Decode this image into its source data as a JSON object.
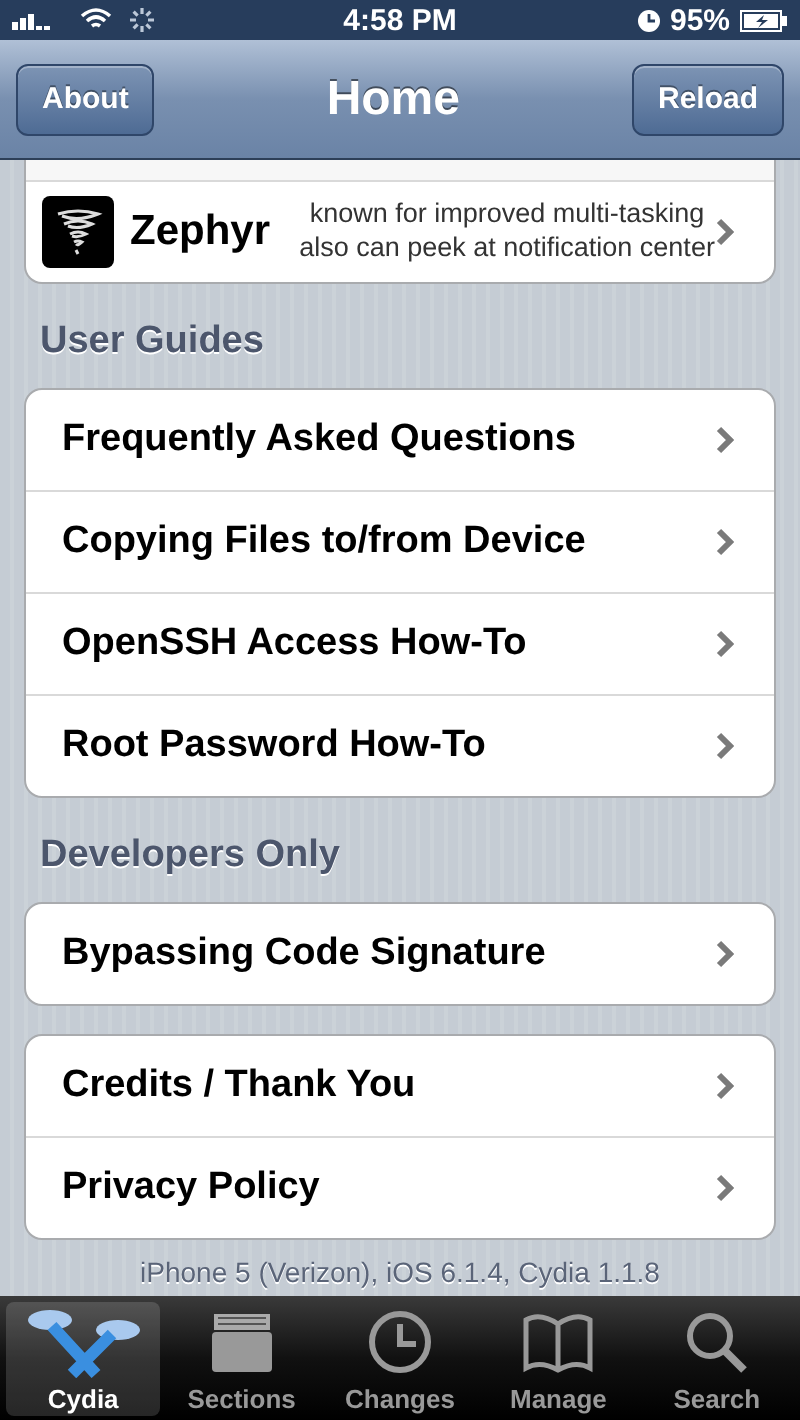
{
  "status_bar": {
    "time": "4:58 PM",
    "battery": "95%"
  },
  "nav": {
    "left_button": "About",
    "title": "Home",
    "right_button": "Reload"
  },
  "featured": [
    {
      "name": "Zephyr",
      "description": "known for improved multi-tasking also can peek at notification center"
    }
  ],
  "sections": [
    {
      "header": "User Guides",
      "rows": [
        {
          "label": "Frequently Asked Questions"
        },
        {
          "label": "Copying Files to/from Device"
        },
        {
          "label": "OpenSSH Access How-To"
        },
        {
          "label": "Root Password How-To"
        }
      ]
    },
    {
      "header": "Developers Only",
      "rows": [
        {
          "label": "Bypassing Code Signature"
        }
      ]
    },
    {
      "rows": [
        {
          "label": "Credits / Thank You"
        },
        {
          "label": "Privacy Policy"
        }
      ]
    }
  ],
  "footer": "iPhone 5 (Verizon), iOS 6.1.4, Cydia 1.1.8",
  "tab_bar": [
    {
      "kind": "cydia",
      "label": "Cydia",
      "selected": true
    },
    {
      "kind": "sections",
      "label": "Sections",
      "selected": false
    },
    {
      "kind": "changes",
      "label": "Changes",
      "selected": false
    },
    {
      "kind": "manage",
      "label": "Manage",
      "selected": false
    },
    {
      "kind": "search",
      "label": "Search",
      "selected": false
    }
  ]
}
